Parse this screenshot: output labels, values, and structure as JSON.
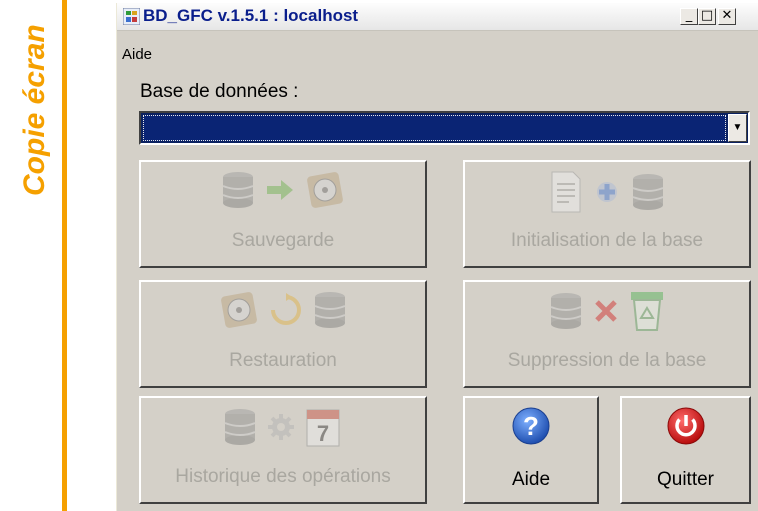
{
  "side_caption": "Copie écran",
  "window": {
    "title": "BD_GFC v.1.5.1 : localhost",
    "min_glyph": "_",
    "max_glyph": "□",
    "close_glyph": "✕"
  },
  "menu": {
    "items": [
      "Aide"
    ]
  },
  "database": {
    "label": "Base de données :",
    "selected_value": ""
  },
  "buttons": {
    "save": "Sauvegarde",
    "init": "Initialisation de la base",
    "restore": "Restauration",
    "delete": "Suppression de la base",
    "history": "Historique des opérations",
    "help": "Aide",
    "quit": "Quitter"
  },
  "calendar_day": "7",
  "colors": {
    "accent_orange": "#f5a000",
    "title_blue": "#0a1e8c",
    "selection_blue": "#0a2474",
    "help_blue": "#2a63c9",
    "quit_red": "#d81818"
  }
}
